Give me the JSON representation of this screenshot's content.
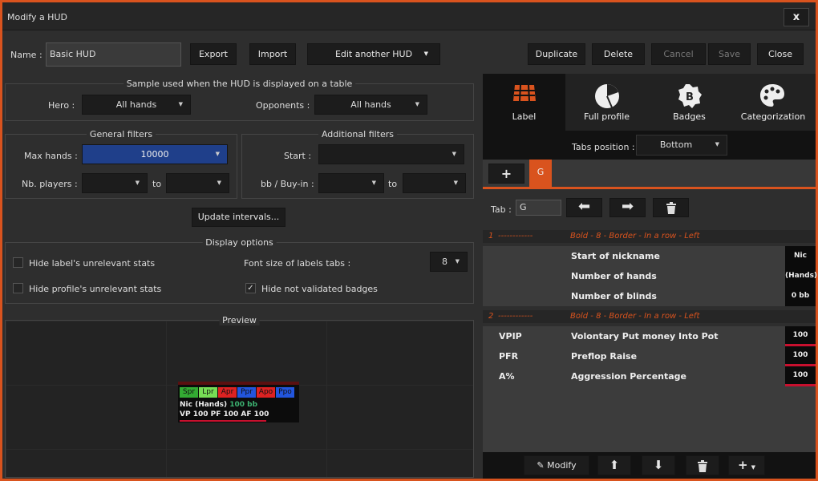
{
  "window": {
    "title": "Modify a HUD",
    "close_label": "x"
  },
  "top": {
    "name_label": "Name :",
    "name_value": "Basic HUD",
    "export": "Export",
    "import": "Import",
    "edit_another": "Edit another HUD",
    "duplicate": "Duplicate",
    "delete": "Delete",
    "cancel": "Cancel",
    "save": "Save",
    "close": "Close"
  },
  "sample": {
    "title": "Sample used when the HUD is displayed on a table",
    "hero_label": "Hero :",
    "hero_value": "All hands",
    "opp_label": "Opponents :",
    "opp_value": "All hands"
  },
  "general": {
    "title": "General filters",
    "max_hands_label": "Max hands :",
    "max_hands_value": "10000",
    "nb_players_label": "Nb. players :",
    "to": "to"
  },
  "additional": {
    "title": "Additional filters",
    "start_label": "Start :",
    "bb_label": "bb / Buy-in :",
    "to": "to"
  },
  "update_intervals": "Update intervals...",
  "display": {
    "title": "Display options",
    "hide_label": "Hide label's unrelevant stats",
    "hide_profile": "Hide profile's unrelevant stats",
    "font_size_label": "Font size of labels tabs :",
    "font_size_value": "8",
    "hide_badges": "Hide not validated badges",
    "hide_label_checked": false,
    "hide_profile_checked": false,
    "hide_badges_checked": true
  },
  "preview": {
    "title": "Preview",
    "tabs": [
      {
        "label": "Spr",
        "color": "#33aa33"
      },
      {
        "label": "Lpr",
        "color": "#77dd55"
      },
      {
        "label": "Apr",
        "color": "#dd2222"
      },
      {
        "label": "Ppr",
        "color": "#2255dd"
      },
      {
        "label": "Apo",
        "color": "#dd2222"
      },
      {
        "label": "Ppo",
        "color": "#2255dd"
      }
    ],
    "line1_name": "Nic (Hands)",
    "line1_bb": "100 bb",
    "line2": "VP 100 PF 100 AF 100"
  },
  "right": {
    "tabs": [
      {
        "label": "Label",
        "icon": "grid-icon"
      },
      {
        "label": "Full profile",
        "icon": "pie-chart-icon"
      },
      {
        "label": "Badges",
        "icon": "badge-icon"
      },
      {
        "label": "Categorization",
        "icon": "palette-icon"
      }
    ],
    "tabs_position_label": "Tabs position :",
    "tabs_position_value": "Bottom",
    "add_tab": "+",
    "current_tab": "G",
    "tab_label": "Tab :",
    "tab_value": "G",
    "row1_header_num": "1",
    "row1_header_dashes": "------------",
    "row1_header_desc": "Bold - 8 - Border - In a row - Left",
    "row1": [
      {
        "abbr": "",
        "name": "Start of nickname",
        "val": "Nic"
      },
      {
        "abbr": "",
        "name": "Number of hands",
        "val": "(Hands)"
      },
      {
        "abbr": "",
        "name": "Number of blinds",
        "val": "0 bb"
      }
    ],
    "row2_header_num": "2",
    "row2_header_dashes": "------------",
    "row2_header_desc": "Bold - 8 - Border - In a row - Left",
    "row2": [
      {
        "abbr": "VPIP",
        "name": "Volontary Put money Into Pot",
        "val": "100"
      },
      {
        "abbr": "PFR",
        "name": "Preflop Raise",
        "val": "100"
      },
      {
        "abbr": "A%",
        "name": "Aggression Percentage",
        "val": "100"
      }
    ],
    "modify": "Modify"
  },
  "colors": {
    "accent": "#d9531e",
    "selected": "#1f3f8a"
  }
}
